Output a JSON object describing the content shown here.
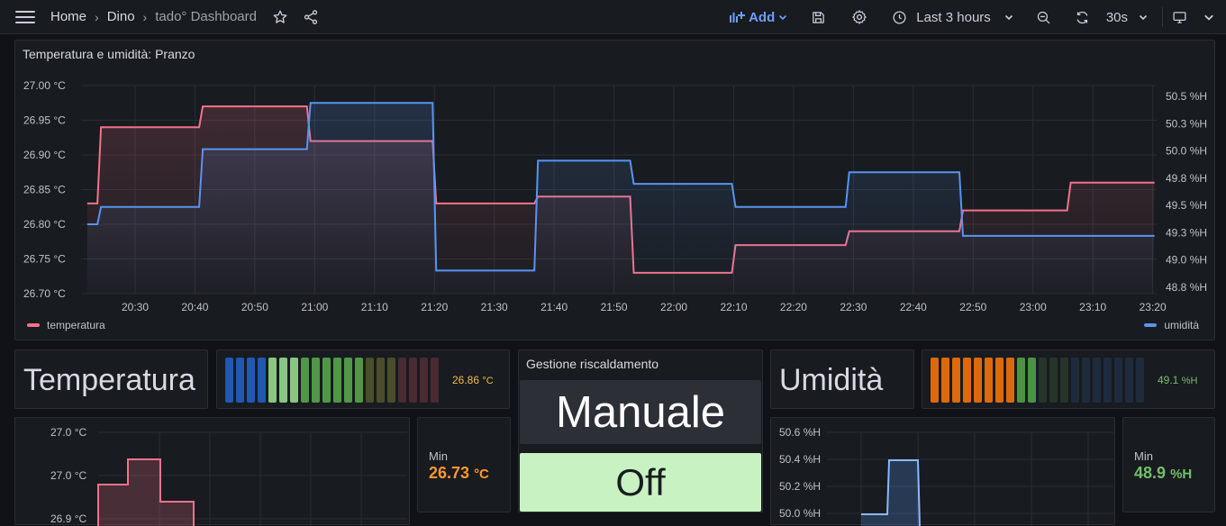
{
  "breadcrumb": {
    "home": "Home",
    "folder": "Dino",
    "dashboard": "tado° Dashboard"
  },
  "toolbar": {
    "add_label": "Add",
    "time_range": "Last 3 hours",
    "refresh": "30s"
  },
  "main_panel": {
    "title": "Temperatura e umidità: Pranzo",
    "legend_left": "temperatura",
    "legend_right": "umidità",
    "temp_color": "#f2728b",
    "hum_color": "#5794f2"
  },
  "chart_data": [
    {
      "type": "line",
      "title": "Temperatura e umidità: Pranzo",
      "x_ticks": [
        "20:30",
        "20:40",
        "20:50",
        "21:00",
        "21:10",
        "21:20",
        "21:30",
        "21:40",
        "21:50",
        "22:00",
        "22:10",
        "22:20",
        "22:30",
        "22:40",
        "22:50",
        "23:00",
        "23:10",
        "23:20"
      ],
      "y_left_ticks": [
        "27.00 °C",
        "26.95 °C",
        "26.90 °C",
        "26.85 °C",
        "26.80 °C",
        "26.75 °C",
        "26.70 °C"
      ],
      "y_right_ticks": [
        "50.5 %H",
        "50.3 %H",
        "50.0 %H",
        "49.8 %H",
        "49.5 %H",
        "49.3 %H",
        "49.0 %H",
        "48.8 %H"
      ],
      "ylim_left": [
        26.7,
        27.0
      ],
      "ylim_right": [
        48.75,
        50.55
      ],
      "series": [
        {
          "name": "temperatura",
          "axis": "left",
          "color": "#f2728b",
          "points": [
            [
              "20:22",
              26.83
            ],
            [
              "20:24",
              26.94
            ],
            [
              "20:41",
              26.97
            ],
            [
              "20:59",
              26.92
            ],
            [
              "21:20",
              26.83
            ],
            [
              "21:37",
              26.84
            ],
            [
              "21:53",
              26.73
            ],
            [
              "22:10",
              26.77
            ],
            [
              "22:29",
              26.79
            ],
            [
              "22:48",
              26.82
            ],
            [
              "23:06",
              26.86
            ],
            [
              "23:20",
              26.86
            ]
          ]
        },
        {
          "name": "umidità",
          "axis": "right",
          "color": "#5794f2",
          "points": [
            [
              "20:22",
              49.35
            ],
            [
              "20:24",
              49.5
            ],
            [
              "20:41",
              50.0
            ],
            [
              "20:59",
              50.4
            ],
            [
              "21:20",
              48.95
            ],
            [
              "21:37",
              49.9
            ],
            [
              "21:53",
              49.7
            ],
            [
              "22:10",
              49.5
            ],
            [
              "22:29",
              49.8
            ],
            [
              "22:48",
              49.25
            ],
            [
              "23:20",
              49.25
            ]
          ]
        }
      ]
    },
    {
      "type": "area",
      "y_ticks": [
        "27.0 °C",
        "27.0 °C",
        "26.9 °C"
      ]
    },
    {
      "type": "area",
      "y_ticks": [
        "50.6 %H",
        "50.4 %H",
        "50.2 %H",
        "50.0 %H"
      ]
    }
  ],
  "temp_label_panel": {
    "text": "Temperatura"
  },
  "temp_gauge": {
    "value": "26.86",
    "unit": "°C",
    "value_color": "#f2b94a"
  },
  "heating_panel": {
    "title": "Gestione riscaldamento",
    "mode": "Manuale",
    "state": "Off"
  },
  "hum_label_panel": {
    "text": "Umidità"
  },
  "hum_gauge": {
    "value": "49.1",
    "unit": "%H",
    "value_color": "#73bf69"
  },
  "temp_min": {
    "label": "Min",
    "value": "26.73",
    "unit": "°C",
    "color": "#ff9830"
  },
  "hum_min": {
    "label": "Min",
    "value": "48.9",
    "unit": "%H",
    "color": "#73bf69"
  }
}
